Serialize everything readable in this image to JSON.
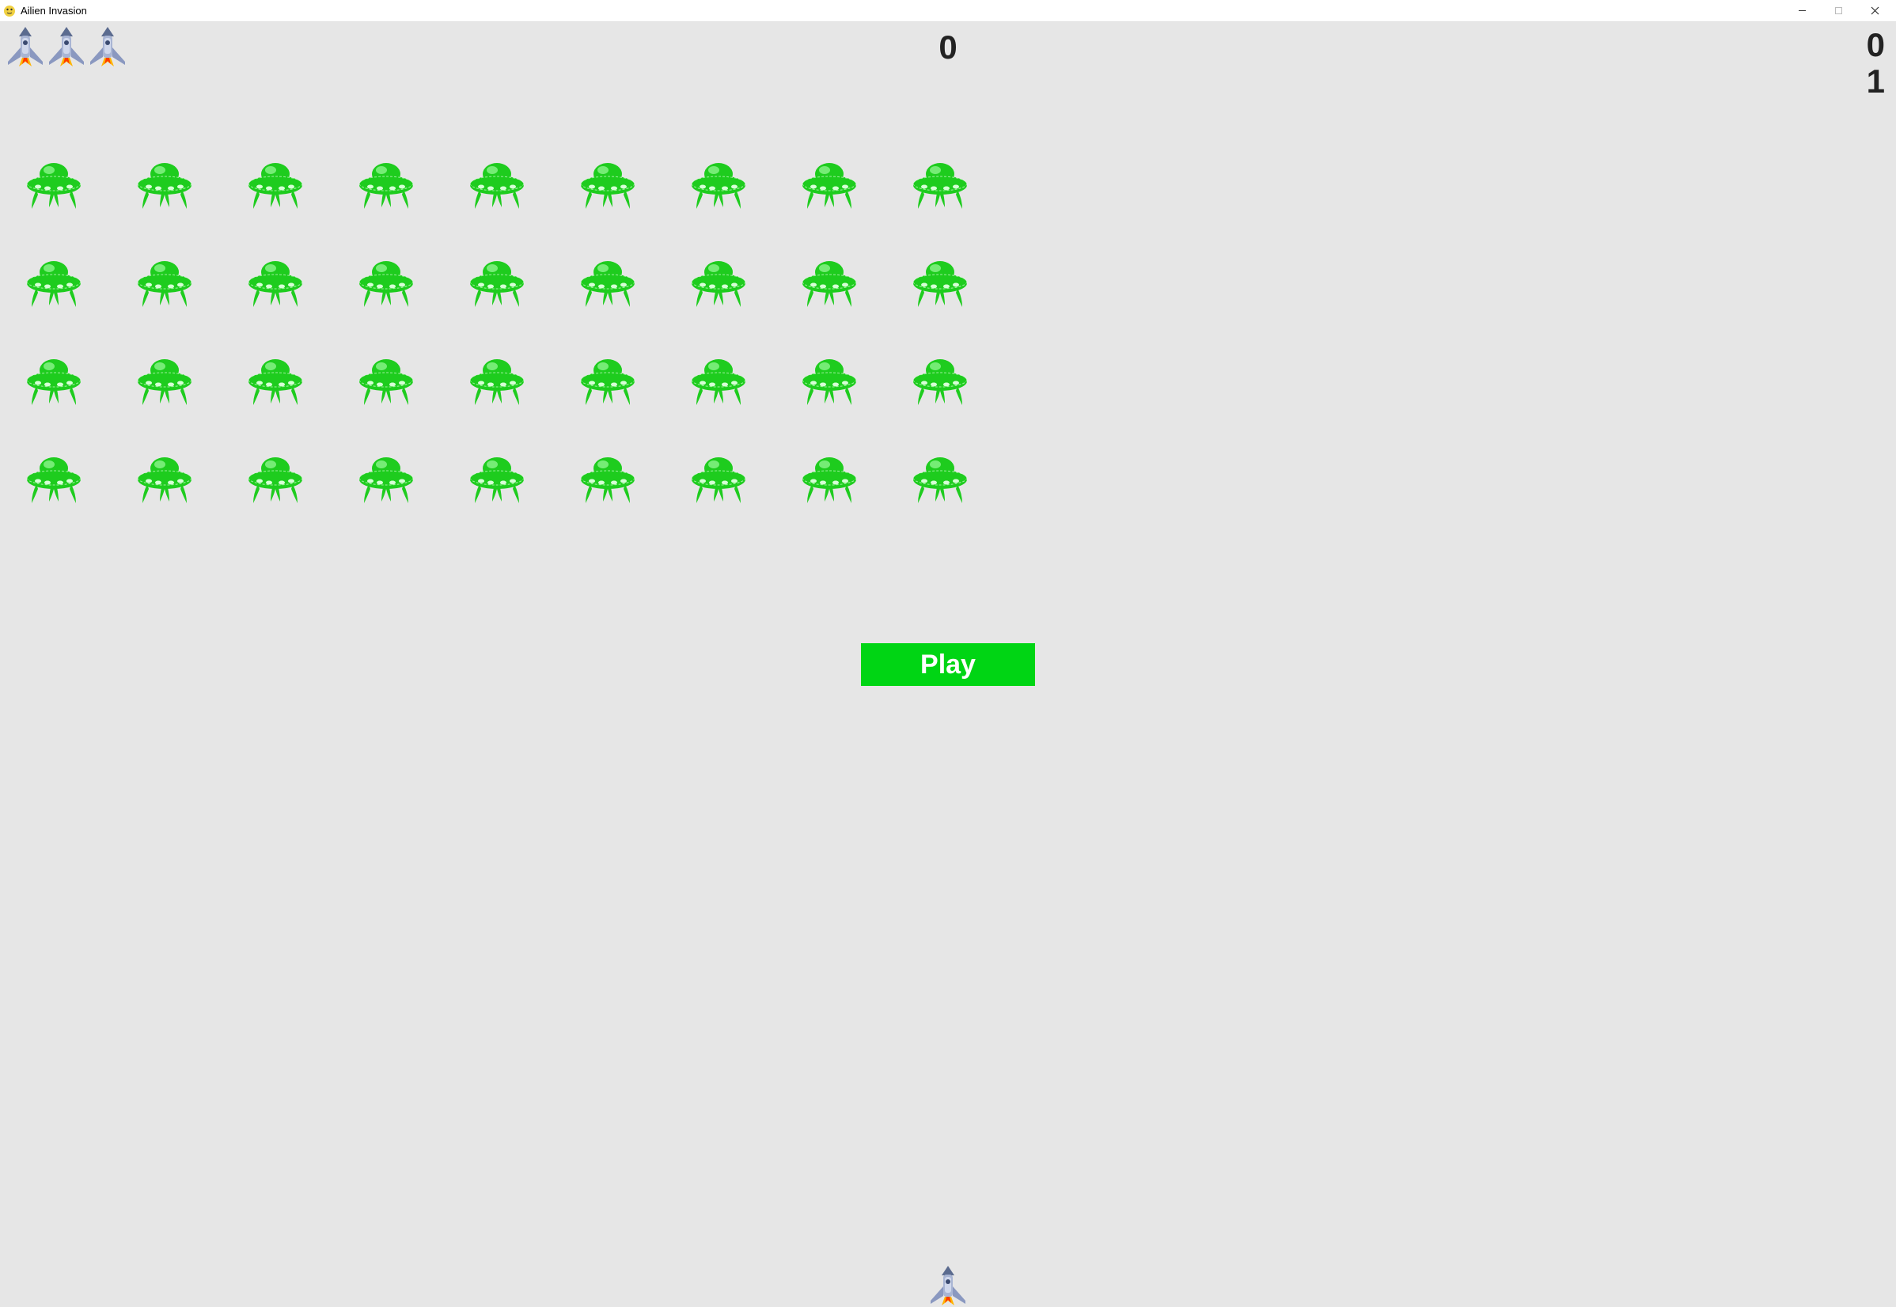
{
  "window": {
    "title": "Ailien Invasion",
    "minimize_glyph": "—",
    "maximize_glyph": "☐",
    "close_glyph": "✕"
  },
  "hud": {
    "lives_count": 3,
    "score": "0",
    "high_score": "0",
    "level": "1"
  },
  "fleet": {
    "rows": 4,
    "cols": 9
  },
  "play_button": {
    "label": "Play"
  },
  "colors": {
    "background": "#e6e6e6",
    "play_button": "#00d514",
    "alien": "#1ecc1e"
  }
}
